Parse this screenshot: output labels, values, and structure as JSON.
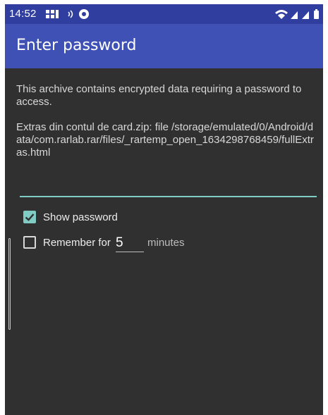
{
  "status_bar": {
    "time": "14:52",
    "left_icons": [
      "app-notification-icon",
      "sound-icon",
      "circle-app-icon"
    ],
    "right_icons": [
      "wifi-icon",
      "signal-icon",
      "signal-icon",
      "battery-icon"
    ]
  },
  "app_bar": {
    "title": "Enter password"
  },
  "dialog": {
    "message": "This archive contains encrypted data requiring a password to access.",
    "file_info": "Extras din contul de card.zip: file /storage/emulated/0/Android/data/com.rarlab.rar/files/_rartemp_open_1634298768459/fullExtras.html",
    "password_value": "",
    "show_password": {
      "label": "Show password",
      "checked": true
    },
    "remember": {
      "label": "Remember for",
      "minutes_value": "5",
      "minutes_suffix": "minutes",
      "checked": false
    }
  },
  "colors": {
    "status_bar": "#303F9F",
    "app_bar": "#3F51B5",
    "background": "#303030",
    "accent": "#80CBC4"
  }
}
